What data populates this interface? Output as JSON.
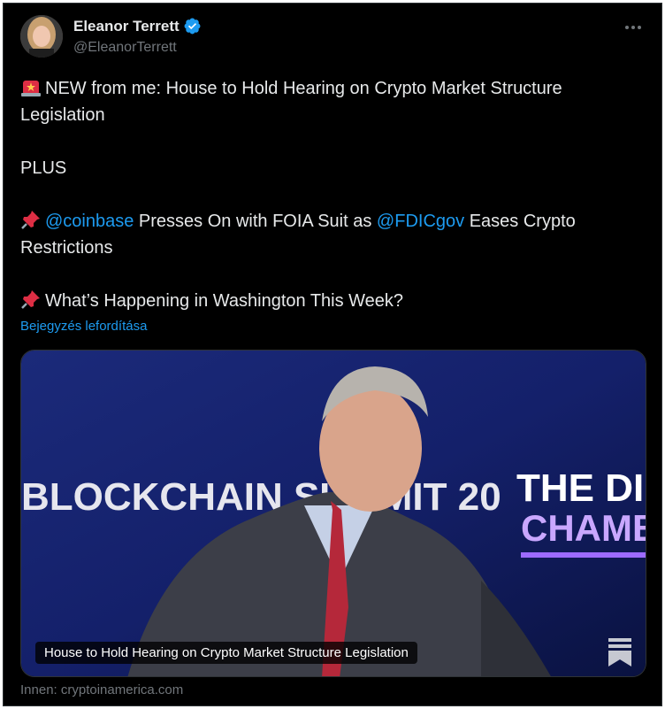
{
  "author": {
    "name": "Eleanor Terrett",
    "handle": "@EleanorTerrett",
    "verified": true
  },
  "tweet": {
    "line1_text": "NEW from me: House to Hold Hearing on Crypto Market Structure Legislation",
    "line1_emoji": "siren-emoji",
    "plus": "PLUS",
    "line2_mention1": "@coinbase",
    "line2_text1": " Presses On with FOIA Suit as ",
    "line2_mention2": "@FDICgov",
    "line2_text2": " Eases Crypto Restrictions",
    "line2_emoji": "pushpin-emoji",
    "line3_text": "What’s Happening in Washington This Week?",
    "line3_emoji": "pushpin-emoji"
  },
  "translate_label": "Bejegyzés lefordítása",
  "card": {
    "caption": "House to Hold Hearing on Crypto Market Structure Legislation",
    "backdrop_left": "BLOCKCHAIN SUMMIT 20",
    "backdrop_right_line1": "THE DIGITAL",
    "backdrop_right_line2": "CHAMBER"
  },
  "source_label": "Innen: cryptoinamerica.com",
  "colors": {
    "background": "#000000",
    "text": "#e7e9ea",
    "secondary": "#71767b",
    "link": "#1d9bf0",
    "verified": "#1d9bf0"
  }
}
